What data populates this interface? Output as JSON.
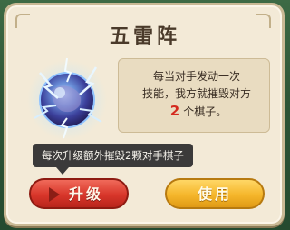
{
  "dialog": {
    "title": "五雷阵"
  },
  "skill": {
    "icon": "thunder-orb-icon",
    "desc_line1": "每当对手发动一次",
    "desc_line2": "技能，我方就摧毁对方",
    "destroy_count": "2",
    "desc_line3_suffix": "个棋子。"
  },
  "tooltip": {
    "text": "每次升级额外摧毁2颗对手棋子"
  },
  "buttons": {
    "upgrade_label": "升级",
    "use_label": "使用"
  },
  "colors": {
    "upgrade_button": "#d8362a",
    "use_button": "#f5b62b",
    "highlight_number": "#d42a1e",
    "panel": "#f3ead7"
  }
}
